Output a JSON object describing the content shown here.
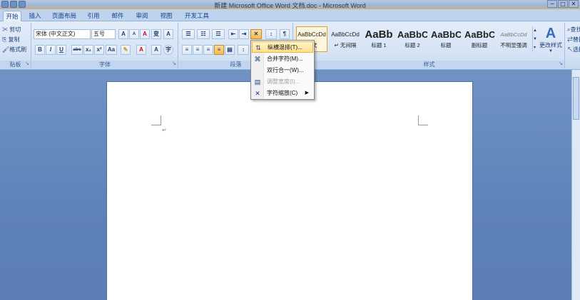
{
  "window": {
    "title": "新建 Microsoft Office Word 文档.doc - Microsoft Word",
    "buttons": [
      "─",
      "□",
      "✕"
    ]
  },
  "tabs": [
    {
      "label": "开始",
      "active": true
    },
    {
      "label": "插入"
    },
    {
      "label": "页面布局"
    },
    {
      "label": "引用"
    },
    {
      "label": "邮件"
    },
    {
      "label": "审阅"
    },
    {
      "label": "视图"
    },
    {
      "label": "开发工具"
    }
  ],
  "clipboard": {
    "cut": "剪切",
    "copy": "复制",
    "format_painter": "格式刷",
    "label": "贴板"
  },
  "font": {
    "font_name": "宋体 (中文正文)",
    "font_size": "五号",
    "label": "字体",
    "buttons": {
      "bold": "B",
      "italic": "I",
      "underline": "U",
      "strike": "abc",
      "sub": "x₂",
      "sup": "x²",
      "case": "Aa",
      "grow": "A",
      "shrink": "A",
      "clear": "A",
      "border": "A",
      "enclose": "字"
    }
  },
  "paragraph": {
    "label": "段落"
  },
  "styles": {
    "label": "样式",
    "items": [
      {
        "sample": "AaBbCcDd",
        "name": "正文",
        "selected": true
      },
      {
        "sample": "AaBbCcDd",
        "name": "↵ 无间隔"
      },
      {
        "sample": "AaBb",
        "name": "标题 1"
      },
      {
        "sample": "AaBbC",
        "name": "标题 2"
      },
      {
        "sample": "AaBbC",
        "name": "标题"
      },
      {
        "sample": "AaBbC",
        "name": "副标题"
      },
      {
        "sample": "AaBbCcDd",
        "name": "不明显强调"
      }
    ],
    "change_styles": "更改样式"
  },
  "editing": {
    "find": "查找",
    "replace": "替换",
    "select": "选择"
  },
  "dropdown_menu": {
    "items": [
      {
        "label": "纵横混排(T)...",
        "icon": "vertical-text-icon",
        "highlighted": true
      },
      {
        "label": "合并字符(M)...",
        "icon": "combine-chars-icon"
      },
      {
        "label": "双行合一(W)...",
        "icon": "two-lines-icon"
      },
      {
        "label": "调整宽度(I)...",
        "icon": "adjust-width-icon",
        "disabled": true
      },
      {
        "label": "字符缩放(C)",
        "icon": "char-scale-icon",
        "submenu": true
      }
    ]
  },
  "document": {
    "paragraph_mark": "↵"
  }
}
